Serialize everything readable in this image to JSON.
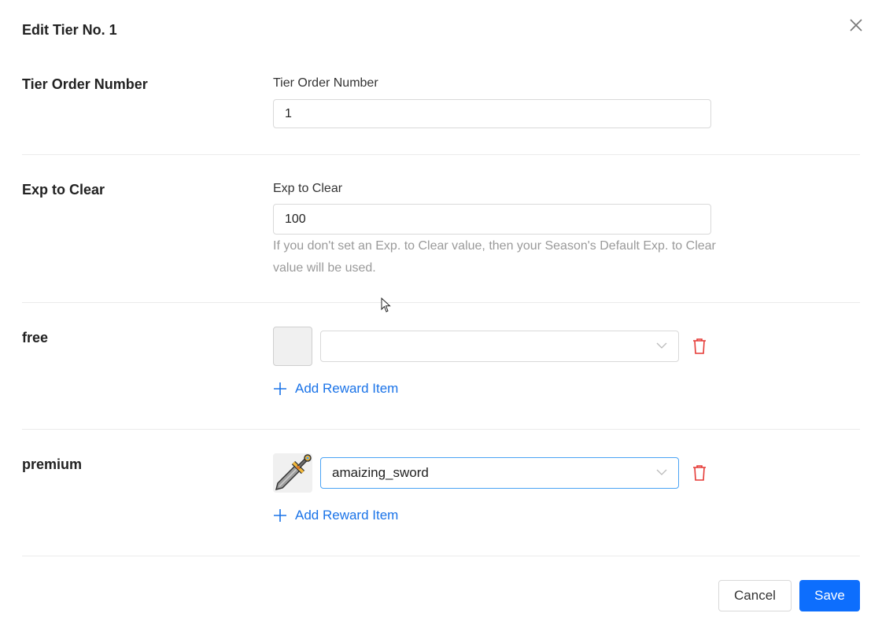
{
  "dialog": {
    "title": "Edit Tier No. 1",
    "close_icon": "close-icon"
  },
  "tier_order": {
    "row_label": "Tier Order Number",
    "field_label": "Tier Order Number",
    "value": "1"
  },
  "exp_to_clear": {
    "row_label": "Exp to Clear",
    "field_label": "Exp to Clear",
    "value": "100",
    "help_text": "If you don't set an Exp. to Clear value, then your Season's Default Exp. to Clear value will be used."
  },
  "free": {
    "row_label": "free",
    "items": [
      {
        "thumbnail": "empty",
        "selected": ""
      }
    ],
    "add_label": "Add Reward Item"
  },
  "premium": {
    "row_label": "premium",
    "items": [
      {
        "thumbnail": "sword-icon",
        "selected": "amaizing_sword"
      }
    ],
    "add_label": "Add Reward Item"
  },
  "footer": {
    "cancel_label": "Cancel",
    "save_label": "Save"
  },
  "colors": {
    "primary": "#0d6efd",
    "link": "#1a73e8",
    "danger": "#e53935",
    "focus": "#4aa3f5"
  }
}
